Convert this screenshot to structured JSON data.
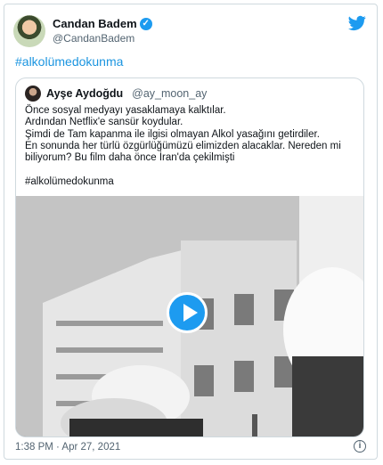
{
  "author": {
    "display_name": "Candan Badem",
    "handle": "@CandanBadem",
    "verified_icon": "verified-check-icon"
  },
  "tweet": {
    "hashtag": "#alkolümedokunma",
    "time": "1:38 PM · Apr 27, 2021"
  },
  "quoted": {
    "display_name": "Ayşe Aydoğdu",
    "handle": "@ay_moon_ay",
    "lines": [
      "Önce sosyal medyayı yasaklamaya kalktılar.",
      "Ardından Netflix'e sansür koydular.",
      "Şimdi de Tam kapanma ile ilgisi olmayan Alkol yasağını getirdiler.",
      "En sonunda her türlü özgürlüğümüzü elimizden alacaklar. Nereden mi",
      "biliyorum? Bu film daha önce İran'da çekilmişti"
    ],
    "hashtag": "#alkolümedokunma"
  },
  "colors": {
    "link": "#1b95e0",
    "brand": "#1d9bf0",
    "secondary_text": "#536471"
  }
}
